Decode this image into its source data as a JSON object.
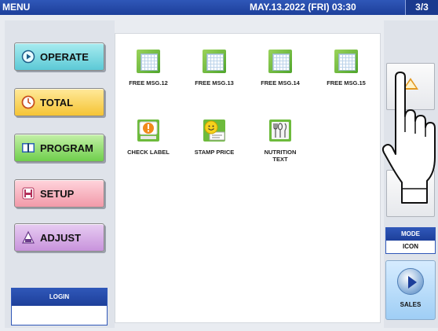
{
  "titlebar": {
    "menu": "MENU",
    "datetime": "MAY.13.2022 (FRI)  03:30",
    "page": "3/3"
  },
  "sidebar": {
    "buttons": [
      {
        "id": "operate",
        "label": "OPERATE",
        "icon": "play-circle-icon"
      },
      {
        "id": "total",
        "label": "TOTAL",
        "icon": "clock-icon"
      },
      {
        "id": "program",
        "label": "PROGRAM",
        "icon": "book-icon"
      },
      {
        "id": "setup",
        "label": "SETUP",
        "icon": "tools-icon"
      },
      {
        "id": "adjust",
        "label": "ADJUST",
        "icon": "scale-icon"
      }
    ],
    "login": {
      "label": "LOGIN",
      "value": ""
    }
  },
  "tiles": [
    {
      "label": "FREE MSG.12",
      "icon": "document-grid-icon"
    },
    {
      "label": "FREE MSG.13",
      "icon": "document-grid-icon"
    },
    {
      "label": "FREE MSG.14",
      "icon": "document-grid-icon"
    },
    {
      "label": "FREE MSG.15",
      "icon": "document-grid-icon"
    },
    {
      "label": "CHECK LABEL",
      "icon": "alert-label-icon"
    },
    {
      "label": "STAMP PRICE",
      "icon": "smiley-stamp-icon"
    },
    {
      "label": "NUTRITION",
      "label2": "TEXT",
      "icon": "cutlery-icon"
    }
  ],
  "rightpanel": {
    "scroll_up_icon": "triangle-up-icon",
    "mode": {
      "label": "MODE",
      "value": "ICON"
    },
    "sales": {
      "label": "SALES",
      "icon": "play-disc-icon"
    }
  },
  "colors": {
    "titlebar": "#1d3f9a",
    "operate": "#5cc9d6",
    "total": "#f5c435",
    "program": "#6fcf4c",
    "setup": "#f19aa9",
    "adjust": "#c893dc",
    "scroll_triangle": "#e39820"
  }
}
